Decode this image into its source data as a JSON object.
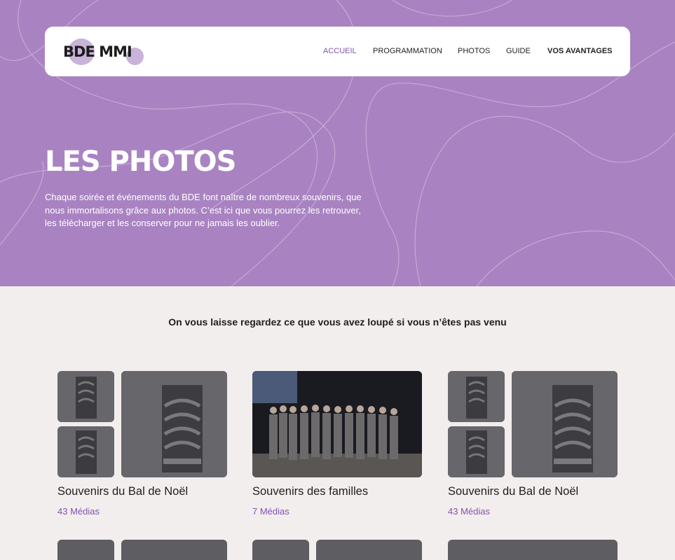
{
  "nav": {
    "logo": "BDE MMI",
    "items": [
      {
        "label": "ACCUEIL",
        "active": true
      },
      {
        "label": "PROGRAMMATION"
      },
      {
        "label": "PHOTOS"
      },
      {
        "label": "GUIDE"
      },
      {
        "label": "VOS AVANTAGES",
        "bold": true
      }
    ]
  },
  "hero": {
    "title": "LES PHOTOS",
    "description": "Chaque soirée et événements du BDE font naître de nombreux souvenirs, que nous immortalisons grâce aux photos. C’est ici que vous pourrez les retrouver, les télécharger et les conserver pour ne jamais les oublier."
  },
  "gallery": {
    "subtitle": "On vous laisse regardez ce que vous avez loupé si vous n’êtes pas venu",
    "albums": [
      {
        "title": "Souvenirs du Bal de Noël",
        "count": "43 Médias",
        "layout": "tshirt-collage"
      },
      {
        "title": "Souvenirs des familles",
        "count": "7 Médias",
        "layout": "group-photo"
      },
      {
        "title": "Souvenirs du Bal de Noël",
        "count": "43 Médias",
        "layout": "tshirt-collage"
      }
    ]
  },
  "colors": {
    "hero_bg": "#a983c1",
    "accent": "#8254ab",
    "page_bg": "#f3eeee"
  }
}
